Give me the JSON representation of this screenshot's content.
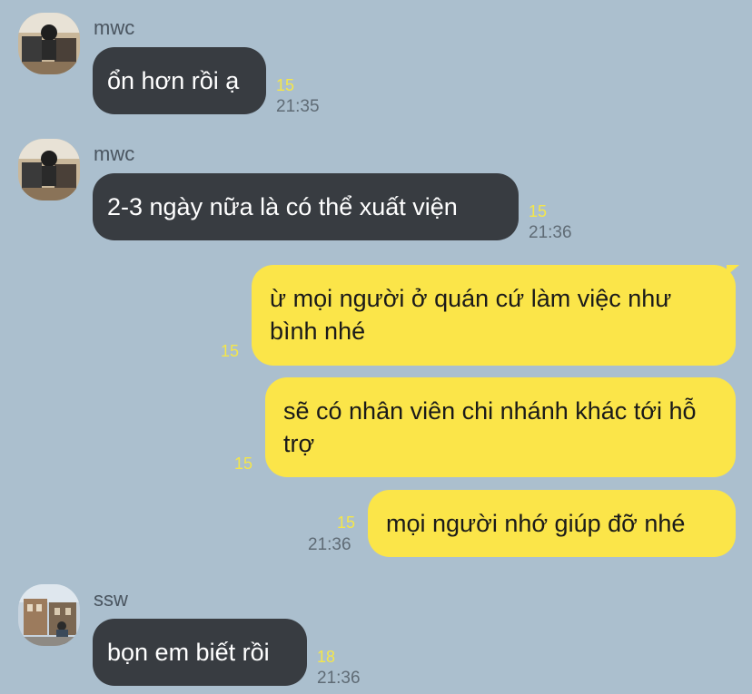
{
  "messages": [
    {
      "type": "incoming",
      "sender": "mwc",
      "text": "ổn hơn rồi ạ",
      "unread": "15",
      "time": "21:35"
    },
    {
      "type": "incoming",
      "sender": "mwc",
      "text": "2-3 ngày nữa là có thể xuất viện",
      "unread": "15",
      "time": "21:36"
    },
    {
      "type": "outgoing",
      "text": "ừ mọi người ở quán cứ làm việc như bình nhé",
      "unread": "15",
      "time": ""
    },
    {
      "type": "outgoing",
      "text": "sẽ có nhân viên chi nhánh khác tới hỗ trợ",
      "unread": "15",
      "time": ""
    },
    {
      "type": "outgoing",
      "text": "mọi người nhớ giúp đỡ nhé",
      "unread": "15",
      "time": "21:36"
    },
    {
      "type": "incoming",
      "sender": "ssw",
      "text": "bọn em biết rồi",
      "unread": "18",
      "time": "21:36"
    }
  ],
  "colors": {
    "background": "#abbfce",
    "incoming_bubble": "#383c41",
    "outgoing_bubble": "#fbe549",
    "unread_count": "#f4e64a"
  },
  "icons": {
    "avatar_mwc": "avatar-photo-mwc",
    "avatar_ssw": "avatar-photo-ssw"
  }
}
